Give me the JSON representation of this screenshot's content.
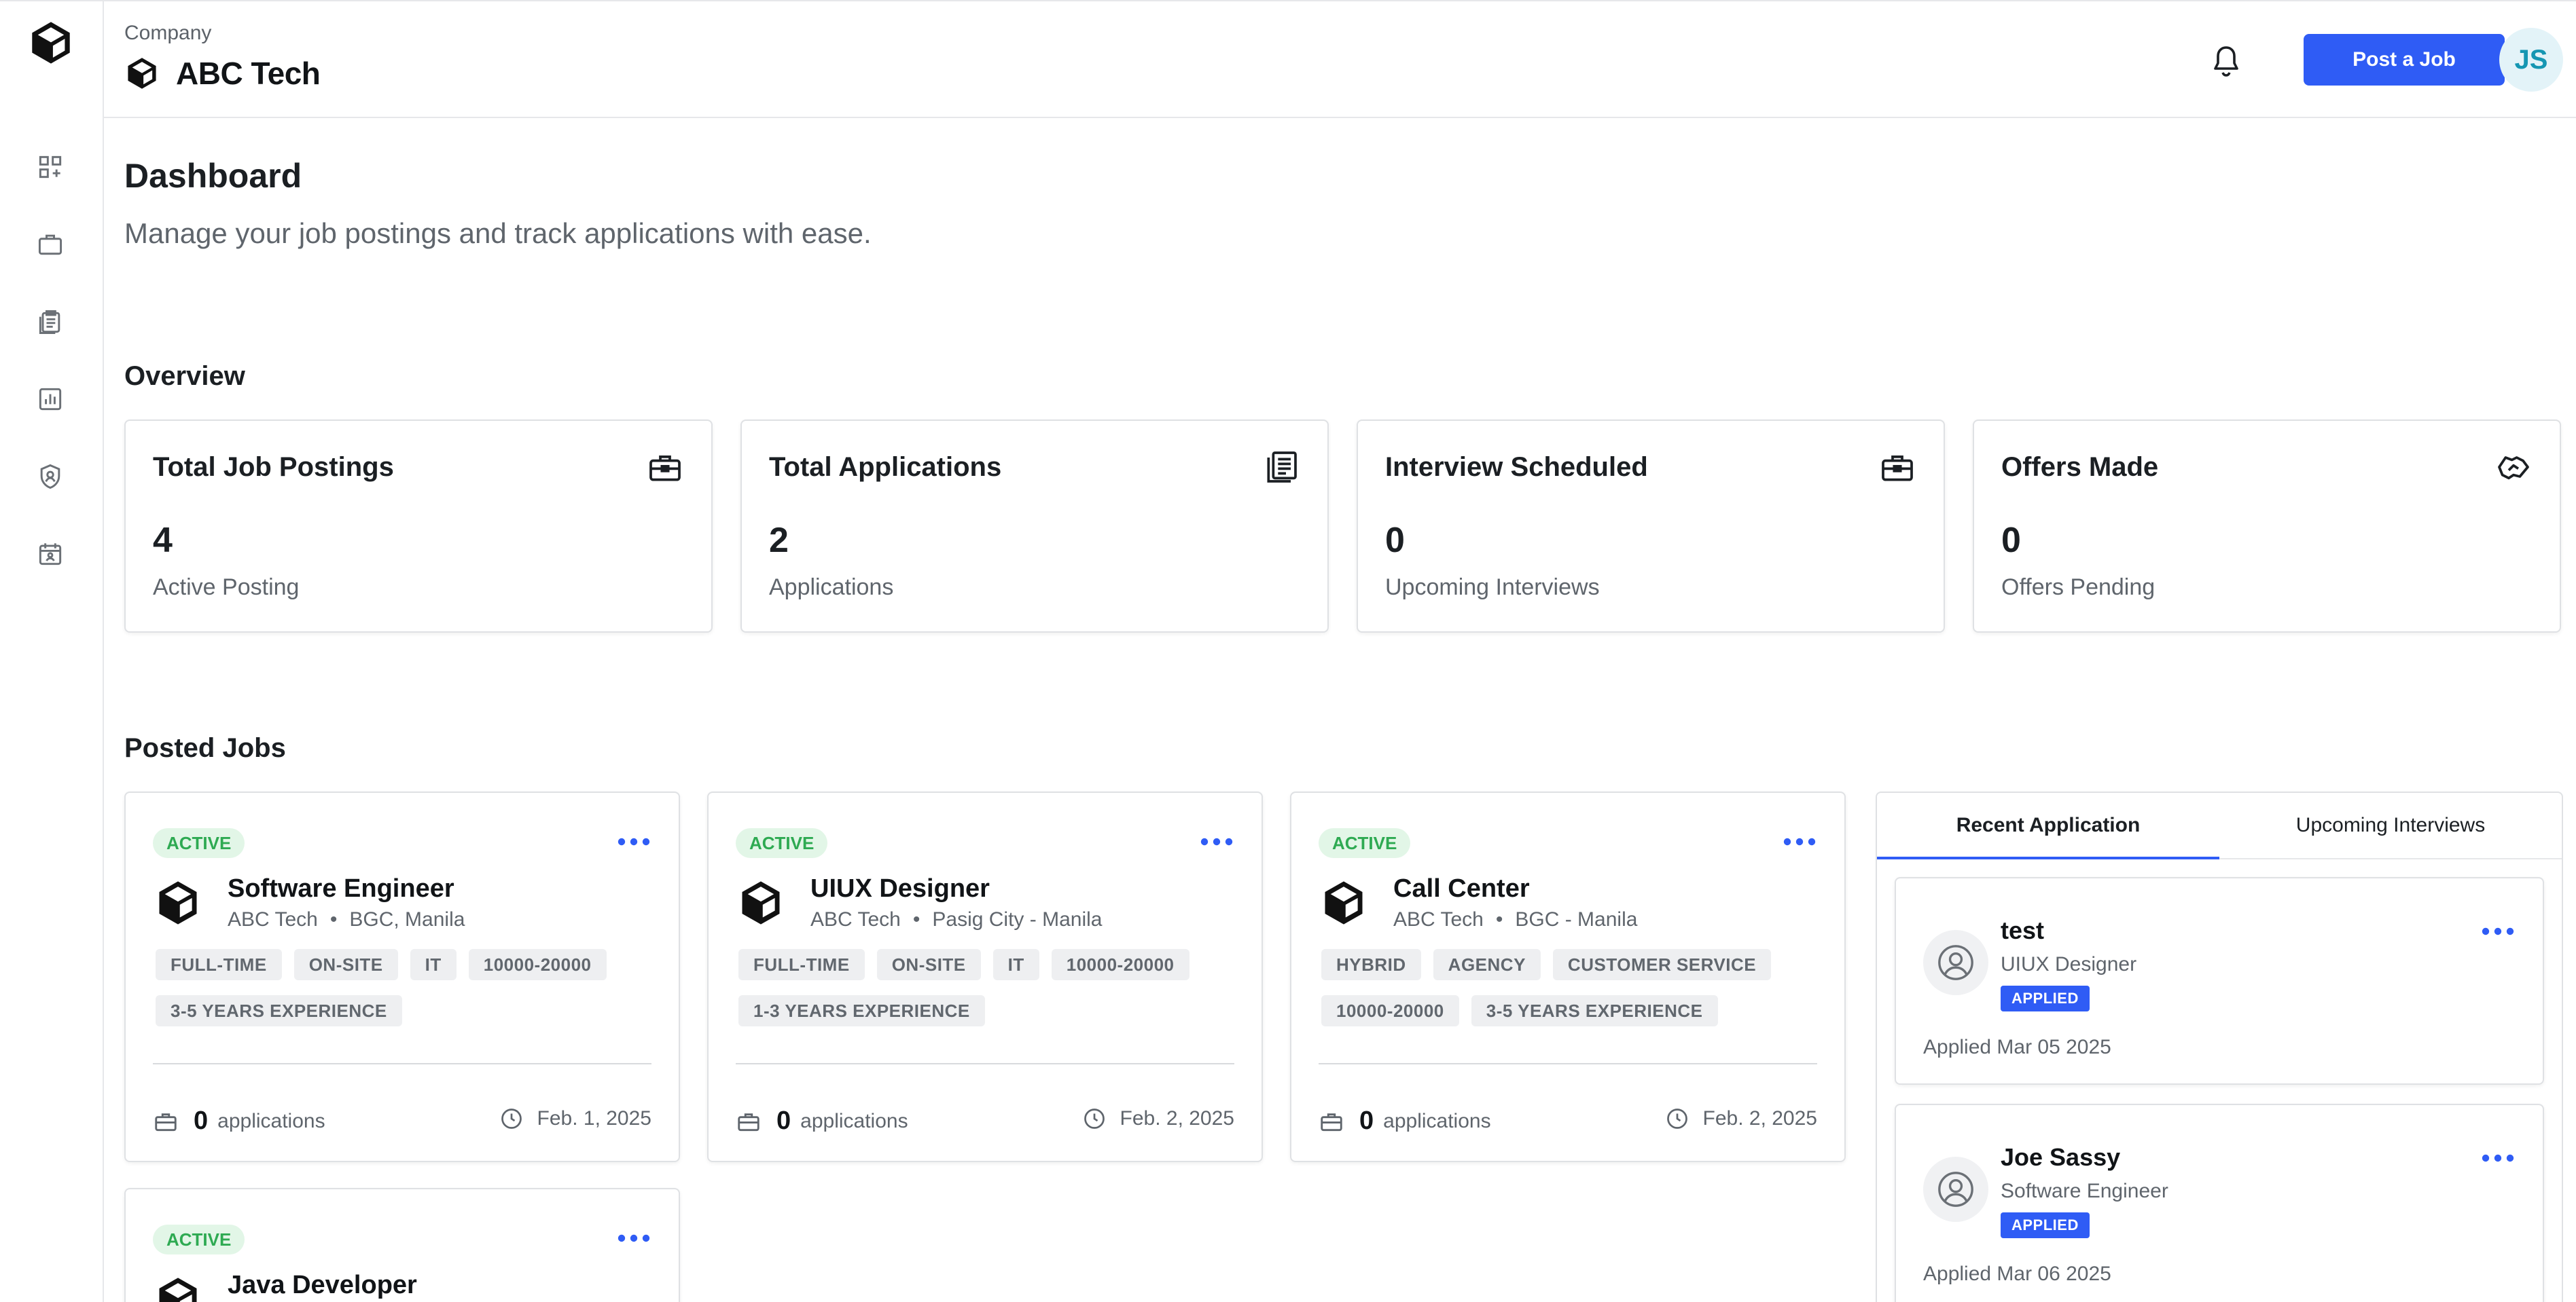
{
  "header": {
    "company_label": "Company",
    "company_name": "ABC Tech",
    "post_button": "Post a Job",
    "avatar_initials": "JS"
  },
  "sidebar": {
    "items": [
      {
        "icon": "dashboard-grid-icon"
      },
      {
        "icon": "briefcase-icon"
      },
      {
        "icon": "clipboard-list-icon"
      },
      {
        "icon": "bar-chart-icon"
      },
      {
        "icon": "shield-user-icon"
      },
      {
        "icon": "calendar-user-icon"
      }
    ]
  },
  "page": {
    "title": "Dashboard",
    "subtitle": "Manage your job postings and track applications with ease.",
    "overview_title": "Overview",
    "posted_jobs_title": "Posted Jobs"
  },
  "stats": [
    {
      "title": "Total Job Postings",
      "value": "4",
      "sub": "Active Posting",
      "icon": "toolbox-icon"
    },
    {
      "title": "Total Applications",
      "value": "2",
      "sub": "Applications",
      "icon": "documents-icon"
    },
    {
      "title": "Interview Scheduled",
      "value": "0",
      "sub": "Upcoming Interviews",
      "icon": "toolbox-icon"
    },
    {
      "title": "Offers Made",
      "value": "0",
      "sub": "Offers Pending",
      "icon": "handshake-icon"
    }
  ],
  "jobs": [
    {
      "status": "ACTIVE",
      "title": "Software Engineer",
      "company": "ABC Tech",
      "location": "BGC, Manila",
      "tags": [
        "FULL-TIME",
        "ON-SITE",
        "IT",
        "10000-20000",
        "3-5 YEARS EXPERIENCE"
      ],
      "applications": "0",
      "applications_label": "applications",
      "date": "Feb. 1, 2025"
    },
    {
      "status": "ACTIVE",
      "title": "UIUX Designer",
      "company": "ABC Tech",
      "location": "Pasig City - Manila",
      "tags": [
        "FULL-TIME",
        "ON-SITE",
        "IT",
        "10000-20000",
        "1-3 YEARS EXPERIENCE"
      ],
      "applications": "0",
      "applications_label": "applications",
      "date": "Feb. 2, 2025"
    },
    {
      "status": "ACTIVE",
      "title": "Call Center",
      "company": "ABC Tech",
      "location": "BGC - Manila",
      "tags": [
        "HYBRID",
        "AGENCY",
        "CUSTOMER SERVICE",
        "10000-20000",
        "3-5 YEARS EXPERIENCE"
      ],
      "applications": "0",
      "applications_label": "applications",
      "date": "Feb. 2, 2025"
    },
    {
      "status": "ACTIVE",
      "title": "Java Developer"
    }
  ],
  "panel": {
    "tabs": [
      "Recent Application",
      "Upcoming Interviews"
    ],
    "applications": [
      {
        "name": "test",
        "role": "UIUX Designer",
        "status": "APPLIED",
        "applied": "Applied Mar 05 2025"
      },
      {
        "name": "Joe Sassy",
        "role": "Software Engineer",
        "status": "APPLIED",
        "applied": "Applied Mar 06 2025"
      }
    ]
  },
  "colors": {
    "accent": "#2f5cf5",
    "active_badge": "#2eaa52",
    "avatar_text": "#1596b2"
  }
}
